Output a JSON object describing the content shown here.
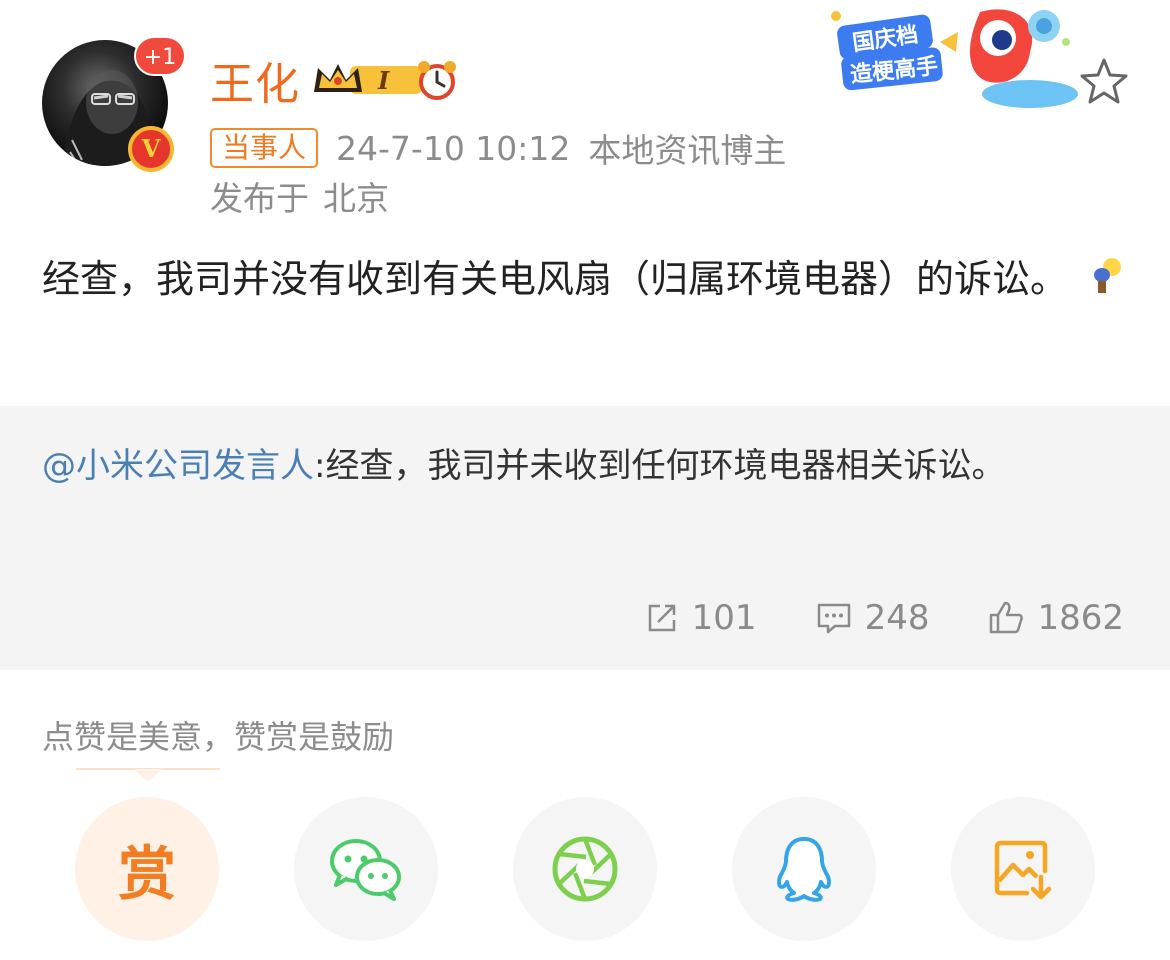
{
  "header": {
    "user_name": "王化",
    "notification_badge": "+1",
    "verified_badge": "V",
    "level_badge": "I",
    "role_tag": "当事人",
    "timestamp": "24-7-10 10:12",
    "blogger_type": "本地资讯博主",
    "location_prefix": "发布于",
    "location": "北京",
    "promo_banner": [
      "国庆档",
      "造梗高手"
    ]
  },
  "post": {
    "text": "经查，我司并没有收到有关电风扇（归属环境电器）的诉讼。"
  },
  "repost": {
    "mention": "@小米公司发言人",
    "text": ":经查，我司并未收到任何环境电器相关诉讼。",
    "stats": {
      "reposts": "101",
      "comments": "248",
      "likes": "1862"
    }
  },
  "reward": {
    "label": "点赞是美意，赞赏是鼓励",
    "reward_button": "赏"
  },
  "colors": {
    "name_orange": "#ef6a1f",
    "mention_blue": "#4a7fb5",
    "repost_bg": "#f4f4f4",
    "wechat_green": "#4ccb6b",
    "moments_green": "#7fcf4e",
    "qq_blue": "#35a5e8",
    "save_orange": "#f5a623"
  },
  "icons": [
    "star-icon",
    "repost-icon",
    "comment-icon",
    "like-icon",
    "wechat-icon",
    "moments-icon",
    "qq-icon",
    "save-image-icon",
    "alarm-clock-icon",
    "crown-icon",
    "bulb-emoji-icon"
  ]
}
